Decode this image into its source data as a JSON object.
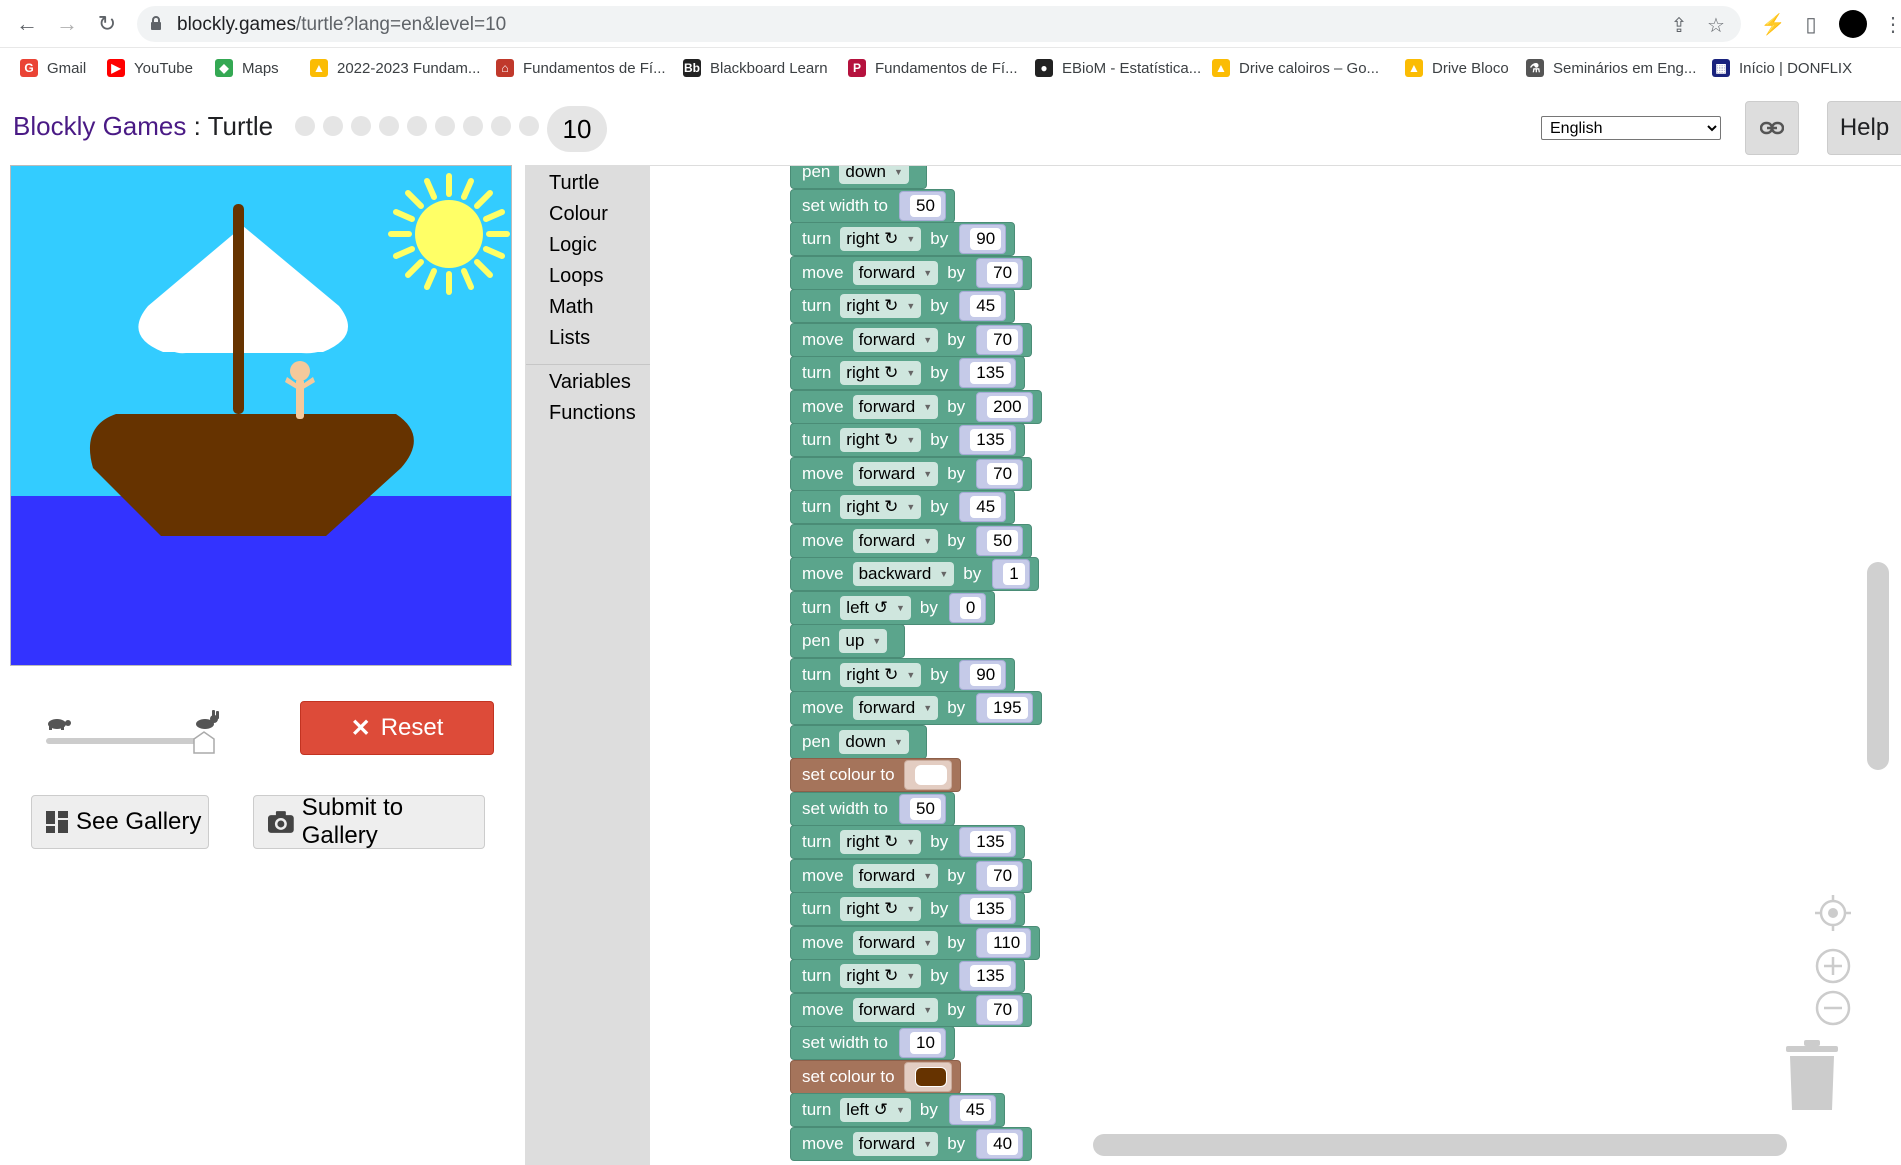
{
  "browser": {
    "url_host": "blockly.games",
    "url_path": "/turtle?lang=en&level=10"
  },
  "bookmarks": [
    {
      "label": "Gmail",
      "color": "#ea4335",
      "glyph": "G"
    },
    {
      "label": "YouTube",
      "color": "#ff0000",
      "glyph": "▶"
    },
    {
      "label": "Maps",
      "color": "#34a853",
      "glyph": "◆"
    },
    {
      "label": "2022-2023 Fundam...",
      "color": "#fbbc04",
      "glyph": "▲"
    },
    {
      "label": "Fundamentos de Fí...",
      "color": "#c0392b",
      "glyph": "⌂"
    },
    {
      "label": "Blackboard Learn",
      "color": "#222222",
      "glyph": "Bb"
    },
    {
      "label": "Fundamentos de Fí...",
      "color": "#b5123e",
      "glyph": "P"
    },
    {
      "label": "EBioM - Estatística...",
      "color": "#222222",
      "glyph": "●"
    },
    {
      "label": "Drive caloiros – Go...",
      "color": "#fbbc04",
      "glyph": "▲"
    },
    {
      "label": "Drive Bloco",
      "color": "#fbbc04",
      "glyph": "▲"
    },
    {
      "label": "Seminários em Eng...",
      "color": "#555555",
      "glyph": "⚗"
    },
    {
      "label": "Início | DONFLIX",
      "color": "#1a237e",
      "glyph": "▦"
    }
  ],
  "app": {
    "brand": "Blockly Games",
    "separator": " : ",
    "name": "Turtle",
    "current_level": "10",
    "level_count": 10,
    "language": "English",
    "help_label": "Help",
    "reset_label": "Reset",
    "see_gallery_label": "See Gallery",
    "submit_gallery_label": "Submit to Gallery",
    "speed": 1.0
  },
  "toolbox": {
    "categories": [
      "Turtle",
      "Colour",
      "Logic",
      "Loops",
      "Math",
      "Lists"
    ],
    "categories2": [
      "Variables",
      "Functions"
    ]
  },
  "blocks": [
    {
      "kind": "pen",
      "t1": "pen",
      "dd": "down"
    },
    {
      "kind": "width",
      "t1": "set width to",
      "num": "50"
    },
    {
      "kind": "turn",
      "t1": "turn",
      "dd": "right ↻",
      "t2": "by",
      "num": "90"
    },
    {
      "kind": "move",
      "t1": "move",
      "dd": "forward",
      "t2": "by",
      "num": "70"
    },
    {
      "kind": "turn",
      "t1": "turn",
      "dd": "right ↻",
      "t2": "by",
      "num": "45"
    },
    {
      "kind": "move",
      "t1": "move",
      "dd": "forward",
      "t2": "by",
      "num": "70"
    },
    {
      "kind": "turn",
      "t1": "turn",
      "dd": "right ↻",
      "t2": "by",
      "num": "135"
    },
    {
      "kind": "move",
      "t1": "move",
      "dd": "forward",
      "t2": "by",
      "num": "200"
    },
    {
      "kind": "turn",
      "t1": "turn",
      "dd": "right ↻",
      "t2": "by",
      "num": "135"
    },
    {
      "kind": "move",
      "t1": "move",
      "dd": "forward",
      "t2": "by",
      "num": "70"
    },
    {
      "kind": "turn",
      "t1": "turn",
      "dd": "right ↻",
      "t2": "by",
      "num": "45"
    },
    {
      "kind": "move",
      "t1": "move",
      "dd": "forward",
      "t2": "by",
      "num": "50"
    },
    {
      "kind": "move",
      "t1": "move",
      "dd": "backward",
      "t2": "by",
      "num": "1"
    },
    {
      "kind": "turn",
      "t1": "turn",
      "dd": "left ↺",
      "t2": "by",
      "num": "0"
    },
    {
      "kind": "pen",
      "t1": "pen",
      "dd": "up"
    },
    {
      "kind": "turn",
      "t1": "turn",
      "dd": "right ↻",
      "t2": "by",
      "num": "90"
    },
    {
      "kind": "move",
      "t1": "move",
      "dd": "forward",
      "t2": "by",
      "num": "195"
    },
    {
      "kind": "pen",
      "t1": "pen",
      "dd": "down"
    },
    {
      "kind": "colour",
      "t1": "set colour to",
      "colour": "#ffffff"
    },
    {
      "kind": "width",
      "t1": "set width to",
      "num": "50"
    },
    {
      "kind": "turn",
      "t1": "turn",
      "dd": "right ↻",
      "t2": "by",
      "num": "135"
    },
    {
      "kind": "move",
      "t1": "move",
      "dd": "forward",
      "t2": "by",
      "num": "70"
    },
    {
      "kind": "turn",
      "t1": "turn",
      "dd": "right ↻",
      "t2": "by",
      "num": "135"
    },
    {
      "kind": "move",
      "t1": "move",
      "dd": "forward",
      "t2": "by",
      "num": "110"
    },
    {
      "kind": "turn",
      "t1": "turn",
      "dd": "right ↻",
      "t2": "by",
      "num": "135"
    },
    {
      "kind": "move",
      "t1": "move",
      "dd": "forward",
      "t2": "by",
      "num": "70"
    },
    {
      "kind": "width",
      "t1": "set width to",
      "num": "10"
    },
    {
      "kind": "colour",
      "t1": "set colour to",
      "colour": "#663300"
    },
    {
      "kind": "turn",
      "t1": "turn",
      "dd": "left ↺",
      "t2": "by",
      "num": "45"
    },
    {
      "kind": "move",
      "t1": "move",
      "dd": "forward",
      "t2": "by",
      "num": "40"
    }
  ],
  "colors": {
    "sky": "#33ccff",
    "sea": "#3333ff",
    "boat": "#663300",
    "sail": "#ffffff",
    "sun": "#ffff66",
    "turtle": "#f5c99b",
    "block_green": "#5ba58c",
    "block_brown": "#a5745b",
    "reset": "#dd4b39"
  }
}
